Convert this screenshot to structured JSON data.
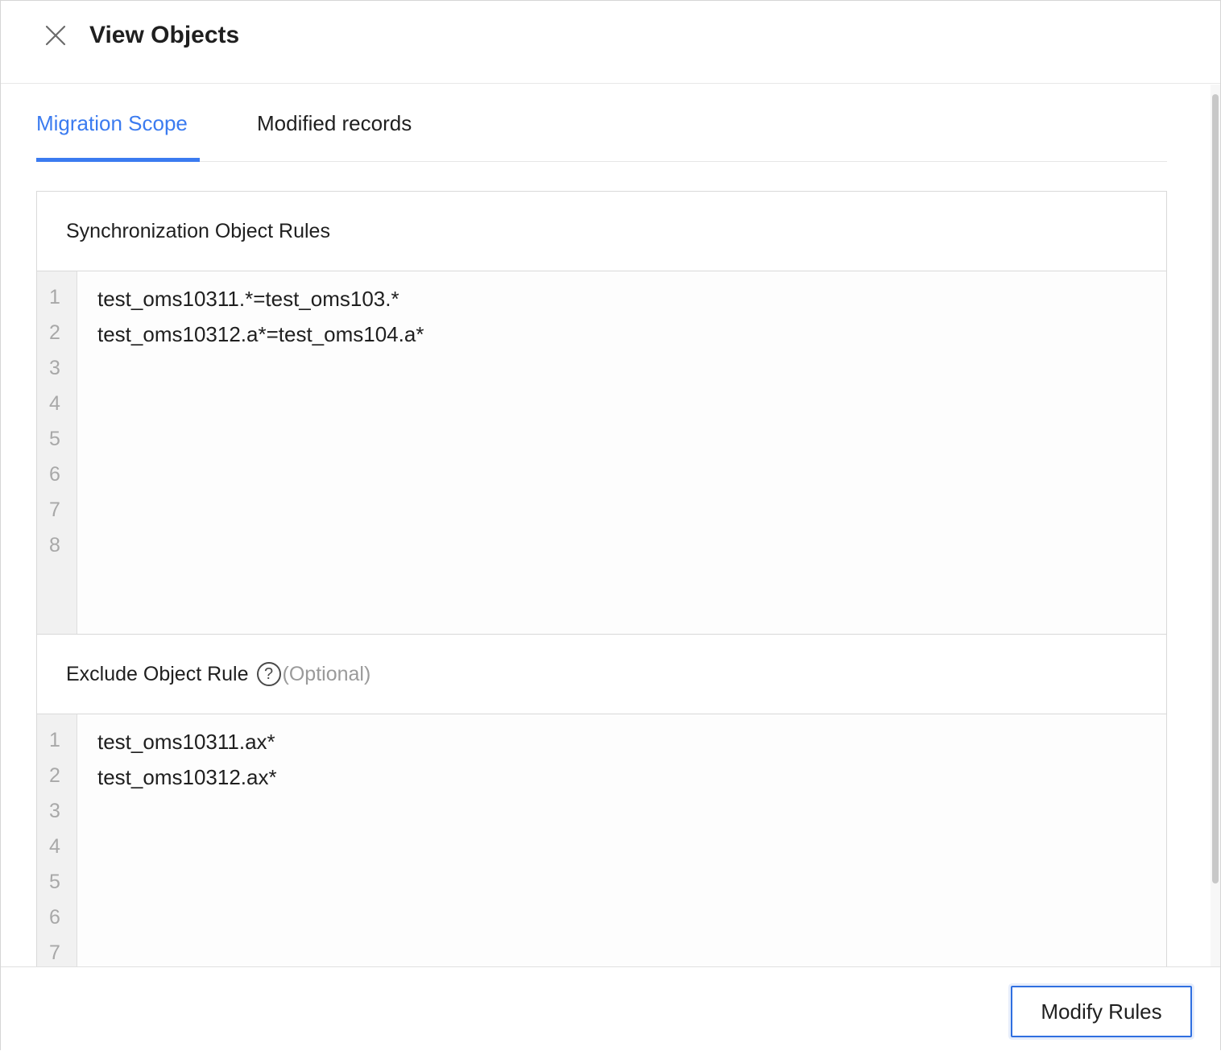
{
  "header": {
    "title": "View Objects",
    "close_icon": "close-icon"
  },
  "tabs": [
    {
      "label": "Migration Scope",
      "active": true
    },
    {
      "label": "Modified records",
      "active": false
    }
  ],
  "sync_rules": {
    "title": "Synchronization Object Rules",
    "line_numbers": [
      "1",
      "2",
      "3",
      "4",
      "5",
      "6",
      "7",
      "8"
    ],
    "lines": [
      "test_oms10311.*=test_oms103.*",
      "test_oms10312.a*=test_oms104.a*"
    ]
  },
  "exclude_rules": {
    "title": "Exclude Object Rule",
    "help_icon": "question-circle-icon",
    "help_glyph": "?",
    "optional_label": "(Optional)",
    "line_numbers": [
      "1",
      "2",
      "3",
      "4",
      "5",
      "6",
      "7"
    ],
    "lines": [
      "test_oms10311.ax*",
      "test_oms10312.ax*"
    ]
  },
  "footer": {
    "modify_label": "Modify Rules"
  },
  "colors": {
    "accent": "#3b7bf0",
    "button_border": "#2f6fe0"
  }
}
